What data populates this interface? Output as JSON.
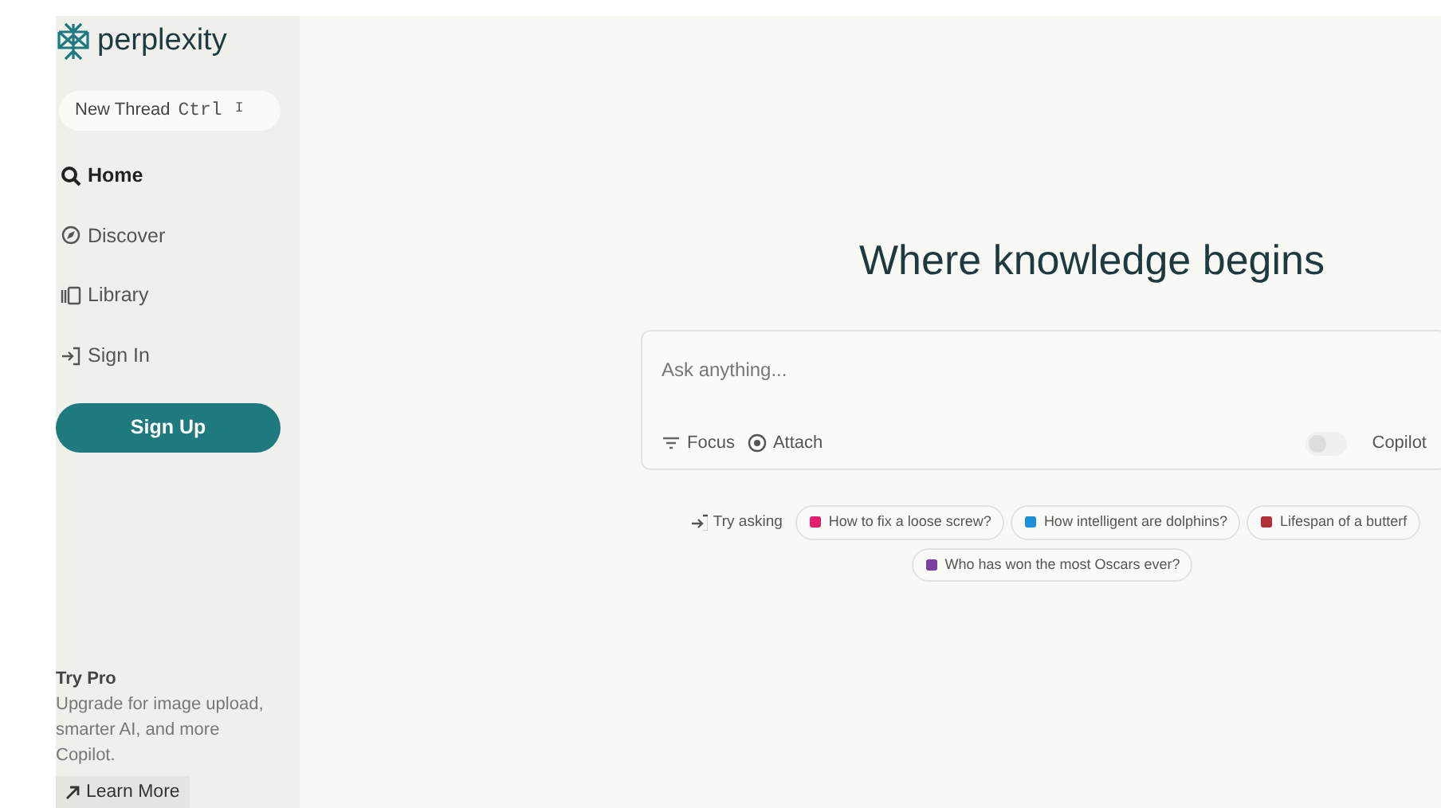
{
  "sidebar": {
    "logo": "perplexity",
    "new_thread": {
      "label": "New Thread",
      "keys": [
        "Ctrl",
        "I"
      ]
    },
    "items": [
      {
        "label": "Home",
        "selected": true
      },
      {
        "label": "Discover",
        "selected": false
      },
      {
        "label": "Library",
        "selected": false
      },
      {
        "label": "Sign In",
        "selected": false
      }
    ],
    "sign_up": "Sign Up",
    "promo": {
      "title": "Try Pro",
      "lines": [
        "Upgrade for image upload,",
        "smarter AI, and more",
        "Copilot."
      ],
      "link": "Learn More"
    }
  },
  "main": {
    "heading": "Where knowledge begins",
    "search": {
      "placeholder": "Ask anything...",
      "actions": [
        {
          "label": "Focus"
        },
        {
          "label": "Attach"
        }
      ],
      "copilot": {
        "label": "Copilot",
        "on": false
      }
    },
    "try_asking": {
      "label": "Try asking",
      "suggestions": [
        {
          "text": "How to fix a loose screw?",
          "color": "#e0206e"
        },
        {
          "text": "How intelligent are dolphins?",
          "color": "#1e90d8"
        },
        {
          "text": "Lifespan of a butterf",
          "color": "#b0303a"
        },
        {
          "text": "Who has won the most Oscars ever?",
          "color": "#7a3fa0"
        }
      ]
    }
  }
}
